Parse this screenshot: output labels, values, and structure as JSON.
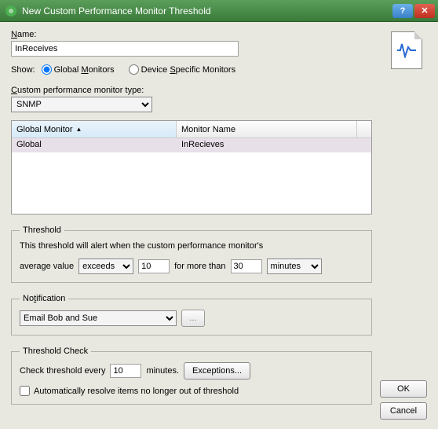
{
  "window": {
    "title": "New Custom Performance Monitor Threshold"
  },
  "name": {
    "label": "Name:",
    "value": "InReceives"
  },
  "show": {
    "label": "Show:",
    "global": "Global Monitors",
    "device": "Device Specific Monitors"
  },
  "type": {
    "label": "Custom performance monitor type:",
    "value": "SNMP"
  },
  "grid": {
    "col0": "Global Monitor",
    "col1": "Monitor Name",
    "rows": [
      {
        "c0": "Global",
        "c1": "InRecieves"
      }
    ]
  },
  "threshold": {
    "legend": "Threshold",
    "desc": "This threshold will alert when the custom performance monitor's",
    "avg": "average value",
    "exceeds": "exceeds",
    "value": "10",
    "forMore": "for more than",
    "duration": "30",
    "unit": "minutes"
  },
  "notification": {
    "legend": "Notification",
    "value": "Email Bob and Sue"
  },
  "check": {
    "legend": "Threshold Check",
    "prefix": "Check threshold every",
    "value": "10",
    "suffix": "minutes.",
    "exceptions": "Exceptions...",
    "auto": "Automatically resolve items no longer out of threshold"
  },
  "buttons": {
    "ok": "OK",
    "cancel": "Cancel"
  }
}
